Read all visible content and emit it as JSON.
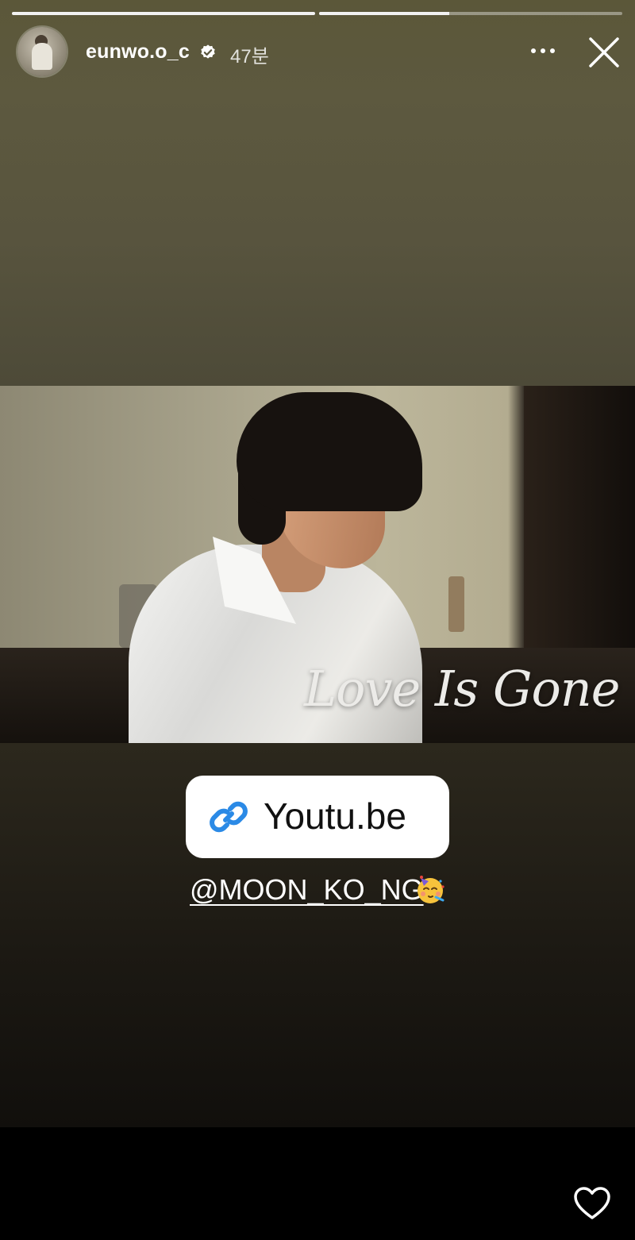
{
  "story": {
    "progress": [
      {
        "fill": 1.0
      },
      {
        "fill": 0.43
      }
    ],
    "header": {
      "username": "eunwo.o_c",
      "verified": true,
      "time": "47분",
      "icons": [
        "avatar",
        "verified-badge-icon",
        "more-options-icon",
        "close-icon"
      ]
    },
    "media": {
      "overlay_title": "Love Is Gone"
    },
    "link_sticker": {
      "label": "Youtu.be",
      "icon": "link-icon",
      "color": "#2b8ae6"
    },
    "mention": {
      "text": "@MOON_KO_NG",
      "emoji": "partying-face-emoji"
    },
    "footer": {
      "icon": "heart-icon"
    }
  }
}
